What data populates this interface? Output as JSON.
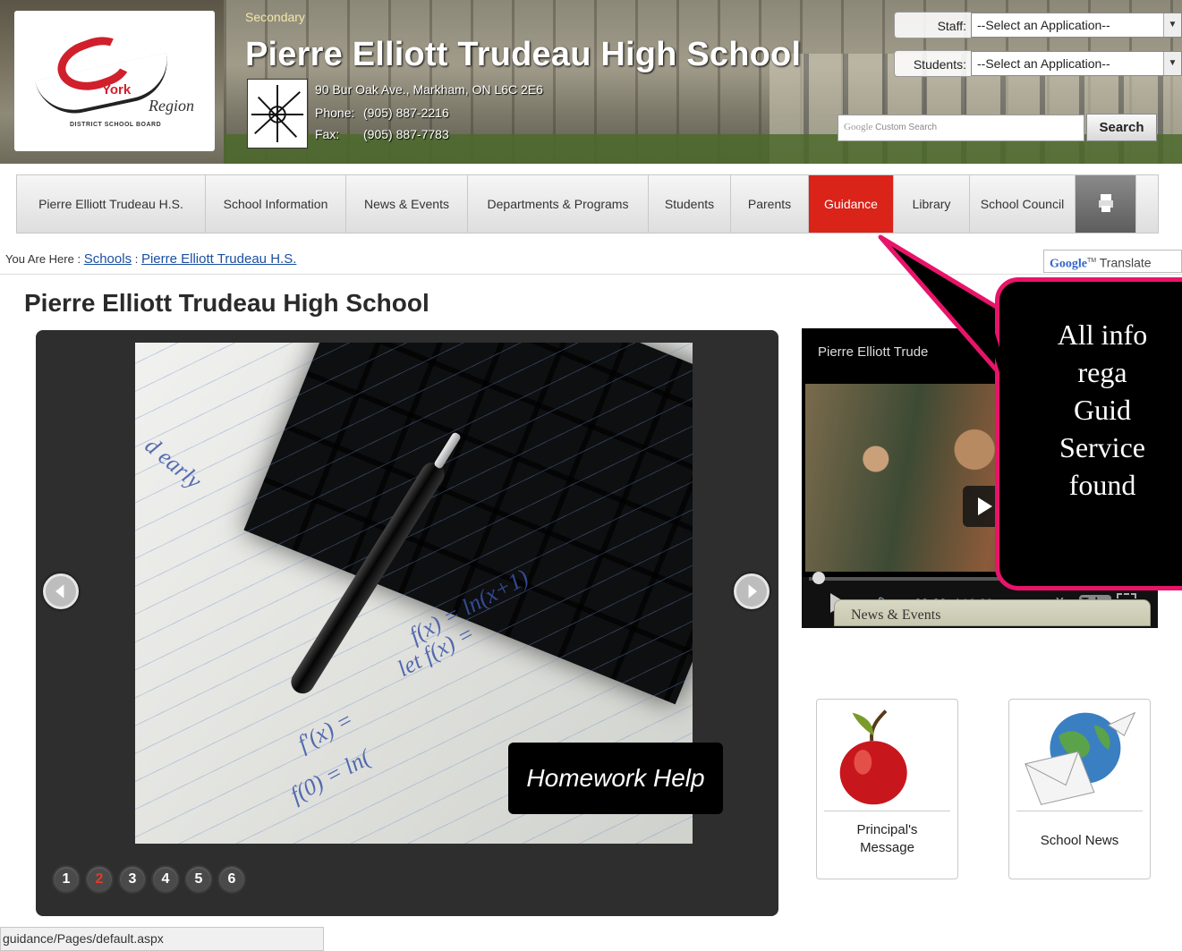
{
  "header": {
    "school_type": "Secondary",
    "school_name": "Pierre Elliott Trudeau High School",
    "address": "90 Bur Oak Ave., Markham, ON  L6C 2E6",
    "phone_label": "Phone:",
    "phone": "(905) 887-2216",
    "fax_label": "Fax:",
    "fax": "(905) 887-7783",
    "board_logo": {
      "york": "York",
      "region": "Region",
      "board": "DISTRICT SCHOOL BOARD"
    },
    "staff_label": "Staff:",
    "staff_select": "--Select an Application--",
    "students_label": "Students:",
    "students_select": "--Select an Application--",
    "search_brand": "Google",
    "search_placeholder": "Custom Search",
    "search_button": "Search"
  },
  "nav": {
    "items": [
      {
        "label": "Pierre Elliott Trudeau H.S."
      },
      {
        "label": "School Information"
      },
      {
        "label": "News & Events"
      },
      {
        "label": "Departments & Programs"
      },
      {
        "label": "Students"
      },
      {
        "label": "Parents"
      },
      {
        "label": "Guidance"
      },
      {
        "label": "Library"
      },
      {
        "label": "School Council"
      }
    ],
    "active": "Guidance"
  },
  "breadcrumb": {
    "prefix": "You Are Here :",
    "items": [
      "Schools",
      "Pierre Elliott Trudeau H.S."
    ],
    "separator": ":"
  },
  "translate": {
    "brand": "Google",
    "label": "Translate"
  },
  "page_title": "Pierre Elliott Trudeau High School",
  "slider": {
    "caption": "Homework Help",
    "pages": [
      "1",
      "2",
      "3",
      "4",
      "5",
      "6"
    ],
    "active_page": "2"
  },
  "video": {
    "title": "Pierre Elliott Trude",
    "current_time": "00:00",
    "duration": "/ 10:29",
    "brand": "You",
    "brand_box": "Tube"
  },
  "callout": {
    "lines": [
      "All info",
      "rega",
      "Guid",
      "Service",
      "found"
    ]
  },
  "tiles": [
    {
      "label_line1": "Principal's",
      "label_line2": "Message"
    },
    {
      "label_line1": "School News",
      "label_line2": ""
    }
  ],
  "news_box_title": "News & Events",
  "status_bar": "guidance/Pages/default.aspx",
  "colors": {
    "nav_active": "#da2319",
    "callout_border": "#e8146a",
    "link": "#1a4f9e"
  }
}
